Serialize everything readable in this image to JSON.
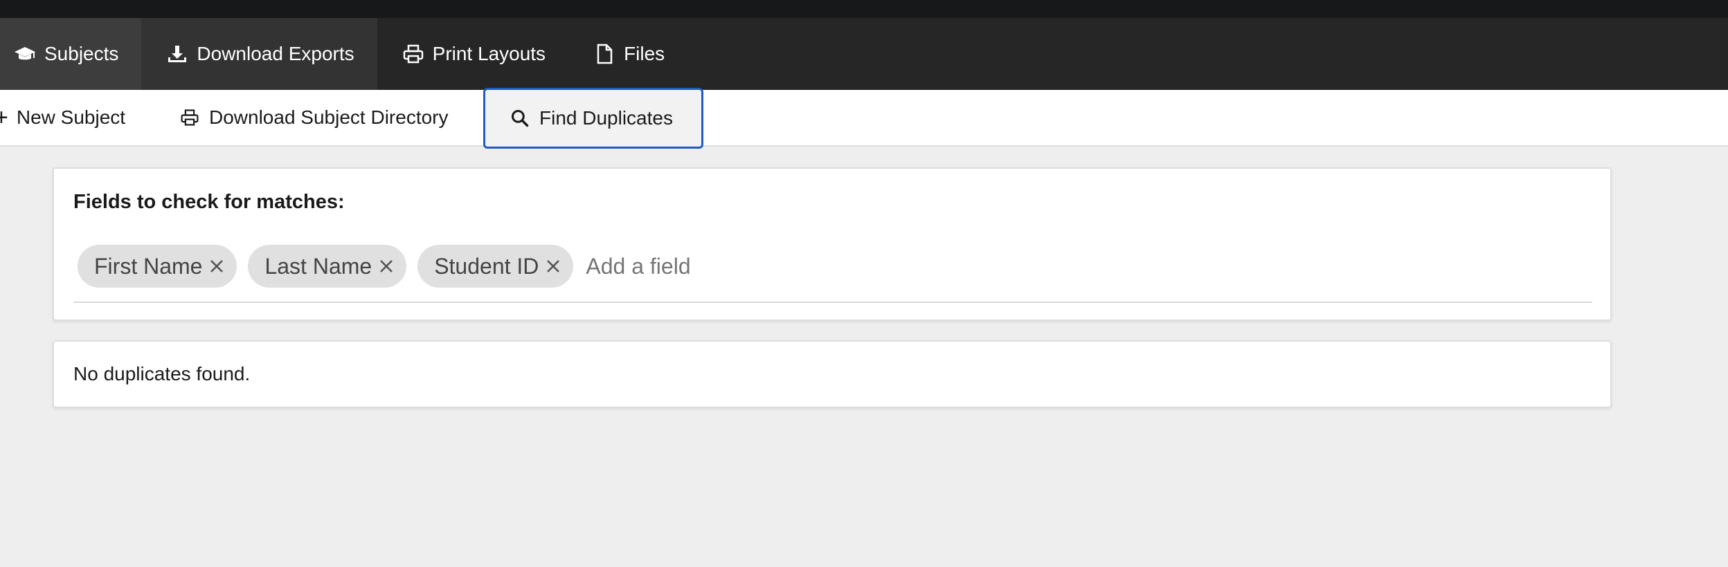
{
  "nav": {
    "tabs": [
      {
        "label": "Subjects",
        "icon": "graduation-cap-icon"
      },
      {
        "label": "Download Exports",
        "icon": "download-icon"
      },
      {
        "label": "Print Layouts",
        "icon": "printer-icon"
      },
      {
        "label": "Files",
        "icon": "file-icon"
      }
    ],
    "active_tab": "Subjects"
  },
  "toolbar": {
    "new_subject_label": "New Subject",
    "download_directory_label": "Download Subject Directory",
    "find_duplicates_label": "Find Duplicates"
  },
  "duplicates": {
    "heading": "Fields to check for matches:",
    "fields": [
      "First Name",
      "Last Name",
      "Student ID"
    ],
    "add_field_placeholder": "Add a field",
    "result_message": "No duplicates found."
  },
  "colors": {
    "navbar_bg": "#262626",
    "active_tab_bg": "#3d3d3d",
    "focus_border": "#1f5bbd",
    "page_bg": "#eeeeee",
    "tag_bg": "#e0e0e0"
  }
}
